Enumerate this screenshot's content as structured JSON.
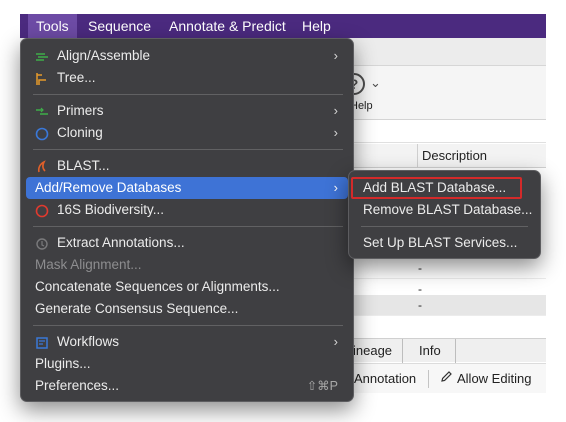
{
  "menubar": {
    "items": [
      "Tools",
      "Sequence",
      "Annotate & Predict",
      "Help"
    ]
  },
  "background": {
    "toolbar": {
      "help_label": "Help",
      "help_glyph": "?",
      "chevron": "⌄"
    },
    "table": {
      "column_header": "Description",
      "rows": [
        "-",
        "-",
        "-"
      ]
    },
    "tabs": [
      "ineage",
      "Info"
    ],
    "bottombar": {
      "annotation": "Annotation",
      "allow_editing": "Allow Editing"
    }
  },
  "tools_menu": {
    "items": [
      {
        "label": "Align/Assemble",
        "icon": "align-assemble-icon",
        "submenu": true
      },
      {
        "label": "Tree...",
        "icon": "tree-icon"
      },
      {
        "label": "Primers",
        "icon": "primers-icon",
        "submenu": true
      },
      {
        "label": "Cloning",
        "icon": "cloning-icon",
        "submenu": true
      },
      {
        "label": "BLAST...",
        "icon": "blast-icon"
      },
      {
        "label": "Add/Remove Databases",
        "submenu": true,
        "highlighted": true
      },
      {
        "label": "16S Biodiversity...",
        "icon": "biodiversity-icon"
      },
      {
        "label": "Extract Annotations...",
        "icon": "extract-annotations-icon"
      },
      {
        "label": "Mask Alignment...",
        "disabled": true
      },
      {
        "label": "Concatenate Sequences or Alignments..."
      },
      {
        "label": "Generate Consensus Sequence..."
      },
      {
        "label": "Workflows",
        "icon": "workflows-icon",
        "submenu": true
      },
      {
        "label": "Plugins..."
      },
      {
        "label": "Preferences...",
        "shortcut": "⇧⌘P"
      }
    ]
  },
  "blast_submenu": {
    "items": [
      {
        "label": "Add BLAST Database..."
      },
      {
        "label": "Remove BLAST Database..."
      },
      {
        "label": "Set Up BLAST Services..."
      }
    ]
  },
  "colors": {
    "menubar": "#4b2a7f",
    "menu_bg": "#3f3f42",
    "highlight": "#3e73d6",
    "callout": "#d42a2a"
  }
}
